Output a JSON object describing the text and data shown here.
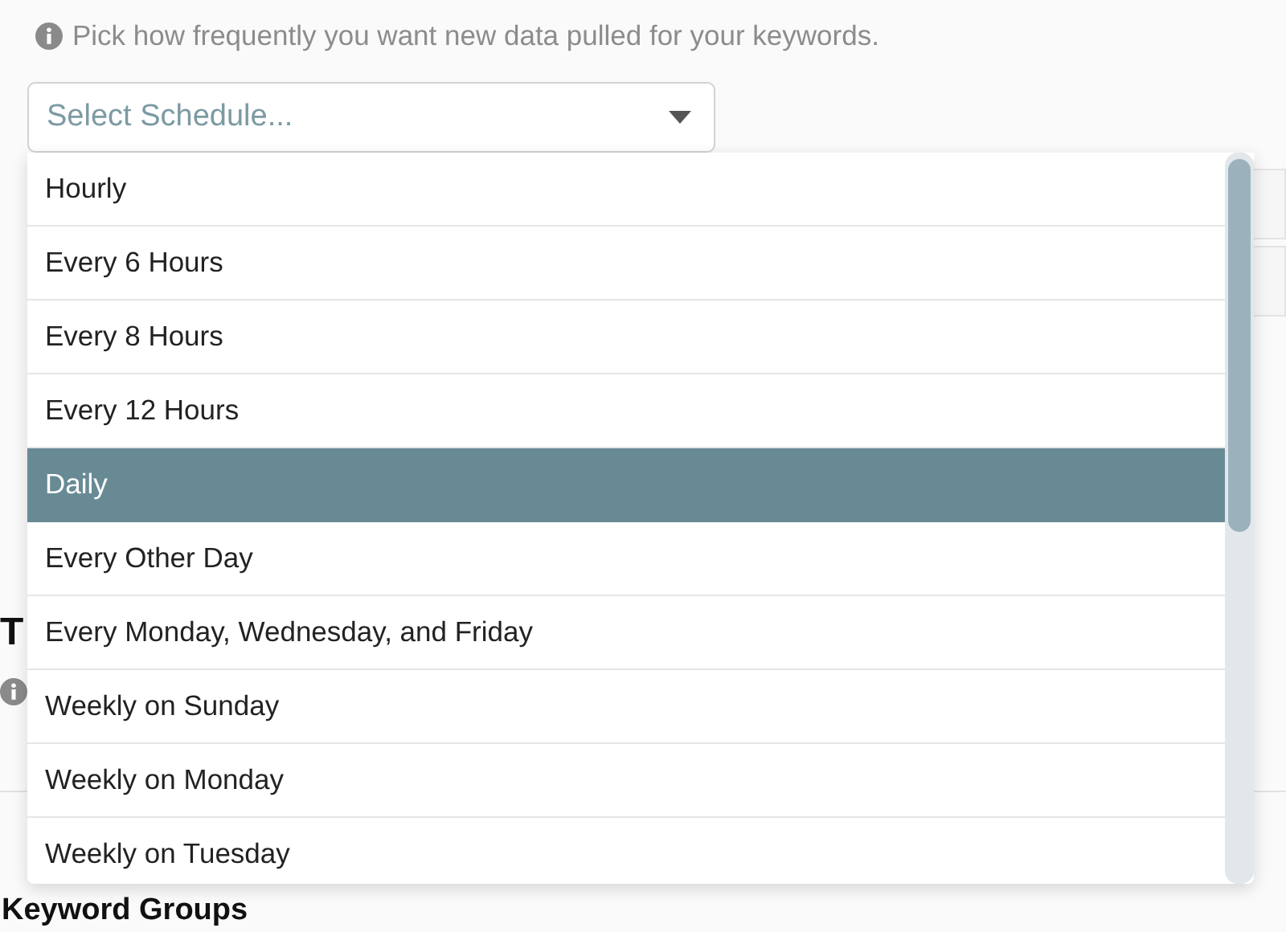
{
  "hint": "Pick how frequently you want new data pulled for your keywords.",
  "select": {
    "placeholder": "Select Schedule..."
  },
  "options": [
    {
      "label": "Hourly",
      "selected": false
    },
    {
      "label": "Every 6 Hours",
      "selected": false
    },
    {
      "label": "Every 8 Hours",
      "selected": false
    },
    {
      "label": "Every 12 Hours",
      "selected": false
    },
    {
      "label": "Daily",
      "selected": true
    },
    {
      "label": "Every Other Day",
      "selected": false
    },
    {
      "label": "Every Monday, Wednesday, and Friday",
      "selected": false
    },
    {
      "label": "Weekly on Sunday",
      "selected": false
    },
    {
      "label": "Weekly on Monday",
      "selected": false
    },
    {
      "label": "Weekly on Tuesday",
      "selected": false
    }
  ],
  "section_heading": "T",
  "next_heading": "Keyword Groups"
}
